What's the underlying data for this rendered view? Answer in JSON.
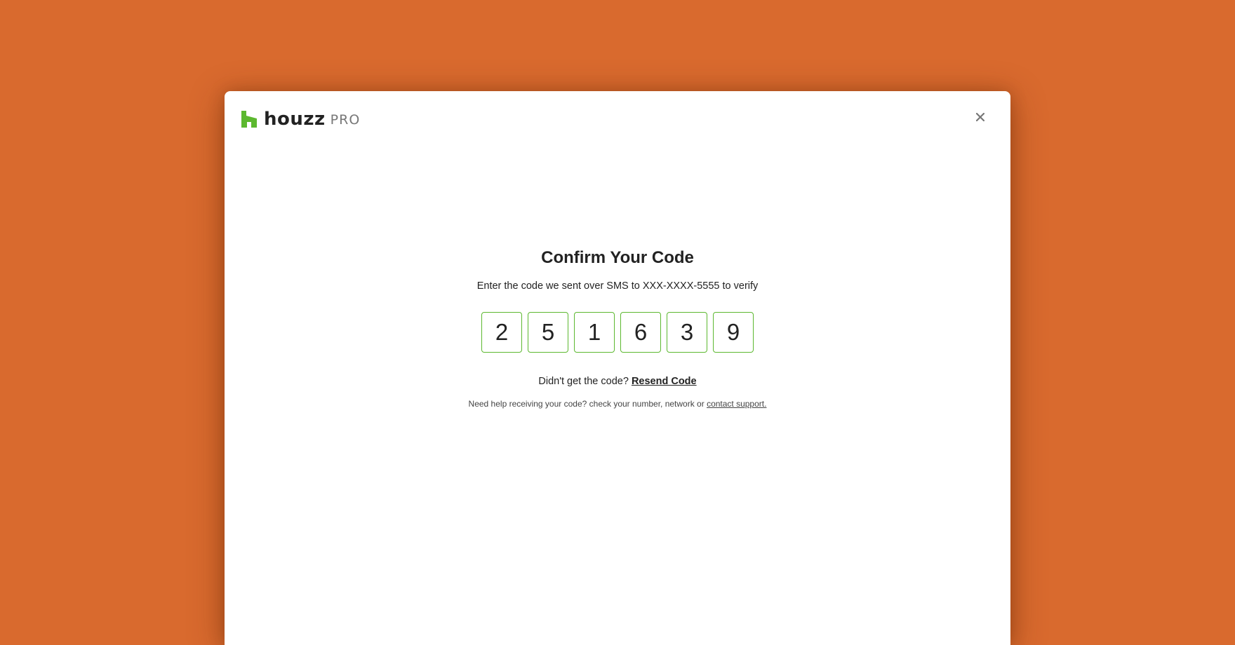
{
  "colors": {
    "background": "#d96a2e",
    "brand_green": "#5cb82f",
    "modal": "#ffffff"
  },
  "header": {
    "logo_word": "houzz",
    "logo_suffix": "PRO",
    "logo_icon": "houzz-logo-icon",
    "close_icon": "close-icon"
  },
  "main": {
    "title": "Confirm Your Code",
    "subtitle": "Enter the code we sent over SMS to XXX-XXXX-5555 to verify",
    "code_digits": [
      "2",
      "5",
      "1",
      "6",
      "3",
      "9"
    ],
    "resend_prompt": "Didn't get the code?",
    "resend_link": "Resend Code",
    "help_text": "Need help receiving your code? check your number, network or",
    "help_link": "contact support."
  }
}
